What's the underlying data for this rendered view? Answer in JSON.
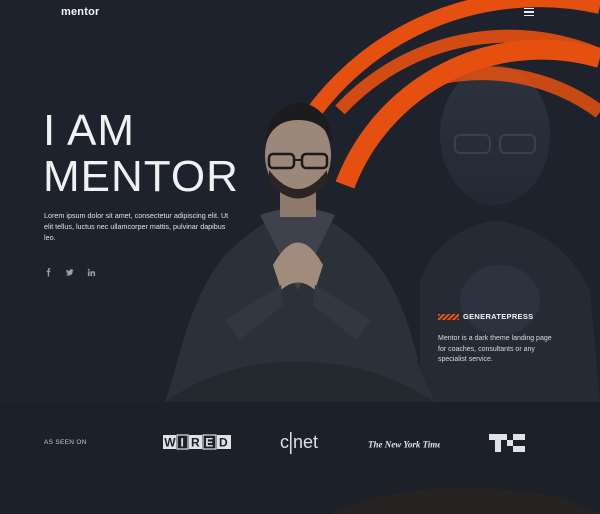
{
  "nav": {
    "brand": "mentor",
    "menu_icon": "hamburger-menu-icon"
  },
  "hero": {
    "title_line1": "I AM",
    "title_line2": "MENTOR",
    "lead": "Lorem ipsum dolor sit amet, consectetur adipiscing elit. Ut elit tellus, luctus nec ullamcorper mattis, pulvinar dapibus leo.",
    "socials": [
      "facebook-icon",
      "twitter-icon",
      "linkedin-icon"
    ],
    "accent_color": "#f0520e"
  },
  "card": {
    "label": "GENERATEPRESS",
    "description": "Mentor is a dark theme landing page for coaches, consultants or any specialist service."
  },
  "press": {
    "label": "AS SEEN ON",
    "logos": [
      "WIRED",
      "c|net",
      "The New York Times",
      "TC"
    ]
  }
}
